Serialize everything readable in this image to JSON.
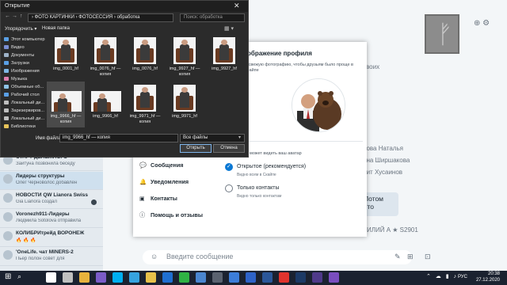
{
  "file_dialog": {
    "title": "Открытие",
    "close": "✕",
    "path": "› ФОТО КАРТИНКИ › ФОТОСЕССИЯ › обработка",
    "search_placeholder": "Поиск: обработка",
    "organize": "Упорядочить ▾",
    "new_folder": "Новая папка",
    "sidebar": [
      {
        "label": "Этот компьютер",
        "color": "#5aa0e6"
      },
      {
        "label": "Видео",
        "color": "#7b8fd4"
      },
      {
        "label": "Документы",
        "color": "#9fb3c8"
      },
      {
        "label": "Загрузки",
        "color": "#5aa0e6"
      },
      {
        "label": "Изображения",
        "color": "#7fb7e6"
      },
      {
        "label": "Музыка",
        "color": "#e07fb0"
      },
      {
        "label": "Объемные об...",
        "color": "#8fc3e6"
      },
      {
        "label": "Рабочий стол",
        "color": "#5aa0e6"
      },
      {
        "label": "Локальный ди...",
        "color": "#bfbfbf"
      },
      {
        "label": "Зарезервиров...",
        "color": "#bfbfbf"
      },
      {
        "label": "Локальный ди...",
        "color": "#bfbfbf"
      },
      {
        "label": "Библиотеки",
        "color": "#e6c35a"
      }
    ],
    "files": [
      {
        "name": "img_0001_hf"
      },
      {
        "name": "img_0076_hf — копия"
      },
      {
        "name": "img_0076_hf"
      },
      {
        "name": "img_9927_hf — копия"
      },
      {
        "name": "img_9927_hf"
      },
      {
        "name": "img_9966_hf — копия"
      },
      {
        "name": "img_9966_hf"
      },
      {
        "name": "img_9971_hf — копия"
      },
      {
        "name": "img_9971_hf"
      }
    ],
    "filename_label": "Имя файла:",
    "filename_value": "img_9966_hf — копия",
    "filetype": "Все файлы",
    "open_button": "Открыть",
    "cancel_button": "Отмена"
  },
  "skype": {
    "chats": [
      {
        "name": "СТАРТ ДЕНЕЖНОГО",
        "preview": "Зайтуна позвонила беседу",
        "selected": false
      },
      {
        "name": "Лидеры структуры",
        "preview": "Олег Черноволос добавлен",
        "selected": true
      },
      {
        "name": "НОВОСТИ QW Lianora Swiss",
        "preview": "Gia Lianora создал",
        "selected": false
      },
      {
        "name": "Voronezh911-Лидеры",
        "preview": "Людмила Sotolova отправила",
        "selected": false
      },
      {
        "name": "КОЛИБРИтрейд ВОРОНЕЖ",
        "preview": "🔥 🔥 🔥",
        "selected": false
      },
      {
        "name": "'OneLife. чат MINERS-2",
        "preview": "Пьер полон совет для",
        "selected": false
      }
    ],
    "contacts": [
      "своих",
      "рова Наталья",
      "ина Ширшакова",
      "бит Хусаинов"
    ],
    "bubble": "Потом что",
    "footer_name": "ИЛИЙ А ★ S2901",
    "compose_placeholder": "Введите сообщение",
    "top_icons": "⊕ ⚙",
    "compose_icons": [
      "✎",
      "☺",
      "⊞",
      "⊡"
    ]
  },
  "profile_modal": {
    "title": "ображение профиля",
    "description": "ю свежую фотографию, чтобы друзьям было проще в Скайпе",
    "who_can_see": "то может видеть ваш аватар",
    "nav": [
      {
        "label": "Сообщения",
        "icon": "💬"
      },
      {
        "label": "Уведомления",
        "icon": "🔔"
      },
      {
        "label": "Контакты",
        "icon": "▣"
      },
      {
        "label": "Помощь и отзывы",
        "icon": "ⓘ"
      }
    ],
    "options": [
      {
        "label": "Открытое (рекомендуется)",
        "sub": "Видно всем в Скайпе",
        "checked": true
      },
      {
        "label": "Только контакты",
        "sub": "Видно только контактам",
        "checked": false
      }
    ]
  },
  "taskbar": {
    "lang": "РУС",
    "time": "20:38",
    "date": "27.12.2020",
    "tray": "⌃ ☁ ▮ ♪",
    "apps": [
      {
        "name": "task-view",
        "color": "#ffffff"
      },
      {
        "name": "yandex",
        "color": "#c0c0c0"
      },
      {
        "name": "chrome",
        "color": "#e8b23c"
      },
      {
        "name": "viber",
        "color": "#7b5cc8"
      },
      {
        "name": "skype",
        "color": "#00aff0"
      },
      {
        "name": "telegram",
        "color": "#36a3e0"
      },
      {
        "name": "explorer",
        "color": "#e8c14a"
      },
      {
        "name": "mail",
        "color": "#1f6fd1"
      },
      {
        "name": "whatsapp",
        "color": "#2fb344"
      },
      {
        "name": "photos",
        "color": "#4a86d0"
      },
      {
        "name": "calculator",
        "color": "#5a6270"
      },
      {
        "name": "calendar",
        "color": "#3c7dd9"
      },
      {
        "name": "app-blue",
        "color": "#2e63c8"
      },
      {
        "name": "word",
        "color": "#2b579a"
      },
      {
        "name": "yandex-red",
        "color": "#e0332d"
      },
      {
        "name": "photoshop",
        "color": "#1c3a66"
      },
      {
        "name": "lightroom",
        "color": "#4f3a8a"
      },
      {
        "name": "app-violet",
        "color": "#7a4ec0"
      }
    ]
  }
}
